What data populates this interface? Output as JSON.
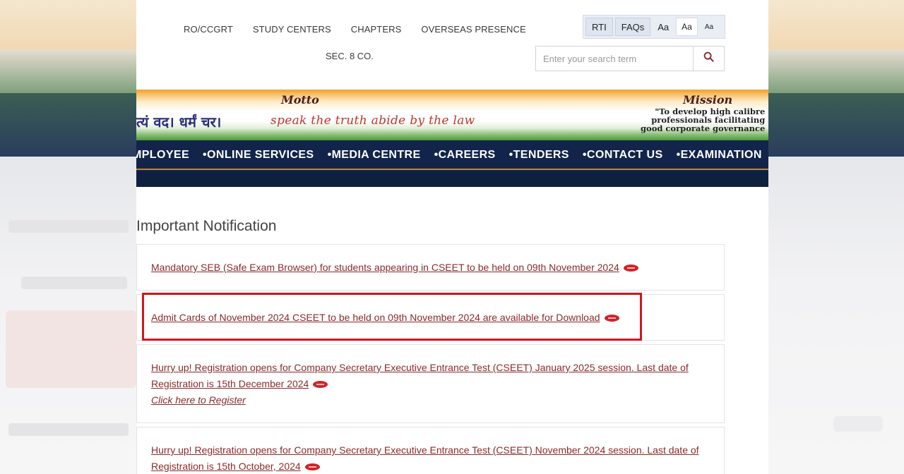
{
  "top_links": {
    "row1": [
      "RO/CCGRT",
      "STUDY CENTERS",
      "CHAPTERS",
      "OVERSEAS PRESENCE"
    ],
    "row2": "SEC. 8 CO."
  },
  "utility": {
    "rti": "RTI",
    "faqs": "FAQs",
    "font_sizes": [
      "Aa",
      "Aa",
      "Aa"
    ]
  },
  "search": {
    "placeholder": "Enter your search term",
    "icon": "search-icon"
  },
  "banner": {
    "motto_heading": "Motto",
    "mission_heading": "Mission",
    "hindi_motto": "त्यं वद। धर्मं चर।",
    "motto_english": "speak the truth abide by the law",
    "mission_line1": "\"To develop high calibre",
    "mission_line2": "professionals facilitating",
    "mission_line3": "good corporate governance"
  },
  "main_nav": [
    "MPLOYEE",
    "•ONLINE SERVICES",
    "•MEDIA CENTRE",
    "•CAREERS",
    "•TENDERS",
    "•CONTACT US",
    "•EXAMINATION"
  ],
  "content": {
    "heading": "Important Notification",
    "notifications": [
      {
        "text": "Mandatory SEB (Safe Exam Browser) for students appearing in CSEET to be held on 09th November 2024"
      },
      {
        "text": "Admit Cards of November 2024 CSEET to be held on 09th November 2024 are available for Download"
      },
      {
        "line1": "Hurry up! Registration opens for Company Secretary Executive Entrance Test (CSEET) January 2025 session. Last date of",
        "line2": "Registration is 15th December 2024",
        "sub": "Click here to Register"
      },
      {
        "line1": "Hurry up! Registration opens for Company Secretary Executive Entrance Test (CSEET) November 2024 session. Last date of",
        "line2": "Registration is 15th October, 2024"
      }
    ]
  },
  "colors": {
    "nav_bg": "#12244a",
    "link": "#8b2a2a",
    "highlight": "#d0161f",
    "badge": "#d0232a"
  }
}
